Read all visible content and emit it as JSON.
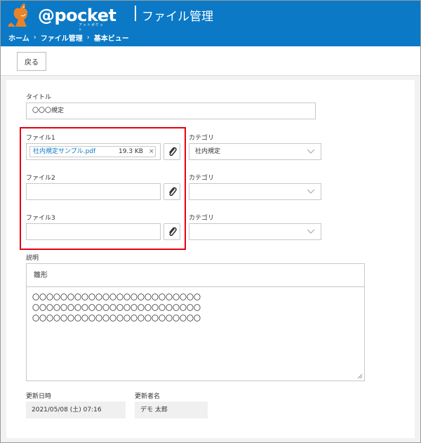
{
  "header": {
    "logo_text": "@pocket",
    "logo_sub": "アットポケット",
    "app_title": "ファイル管理",
    "breadcrumb": [
      "ホーム",
      "ファイル管理",
      "基本ビュー"
    ],
    "breadcrumb_sep": "›",
    "bg_color": "#0b79c6"
  },
  "toolbar": {
    "back_label": "戻る"
  },
  "form": {
    "title_label": "タイトル",
    "title_value": "〇〇〇規定",
    "files": [
      {
        "label": "ファイル1",
        "file_name": "社内規定サンプル.pdf",
        "file_size": "19.3 KB",
        "remove": "×",
        "category_label": "カテゴリ",
        "category_value": "社内規定"
      },
      {
        "label": "ファイル2",
        "file_name": "",
        "file_size": "",
        "category_label": "カテゴリ",
        "category_value": ""
      },
      {
        "label": "ファイル3",
        "file_name": "",
        "file_size": "",
        "category_label": "カテゴリ",
        "category_value": ""
      }
    ],
    "description_label": "説明",
    "description_head": "雛形",
    "description_body": "〇〇〇〇〇〇〇〇〇〇〇〇〇〇〇〇〇〇〇〇〇〇〇〇\n〇〇〇〇〇〇〇〇〇〇〇〇〇〇〇〇〇〇〇〇〇〇〇〇\n〇〇〇〇〇〇〇〇〇〇〇〇〇〇〇〇〇〇〇〇〇〇〇〇",
    "updated_at_label": "更新日時",
    "updated_at_value": "2021/05/08 (土) 07:16",
    "updated_by_label": "更新者名",
    "updated_by_value": "デモ 太郎"
  },
  "colors": {
    "highlight": "#e60012",
    "link": "#0b79c6"
  },
  "icons": {
    "attach": "paperclip-icon",
    "dropdown": "chevron-down-icon"
  }
}
